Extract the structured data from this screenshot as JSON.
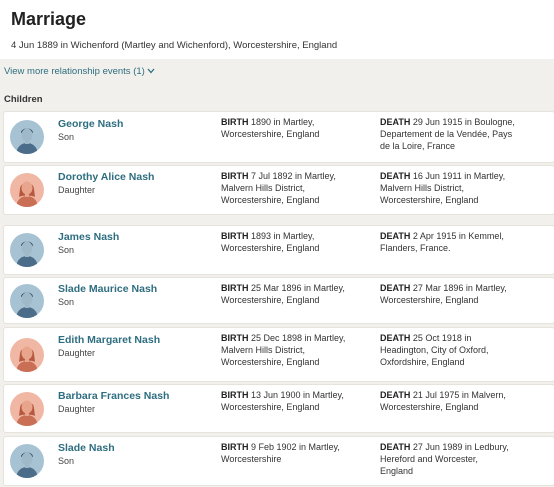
{
  "marriage": {
    "title": "Marriage",
    "detail": "4 Jun 1889 in Wichenford (Martley and Wichenford), Worcestershire, England"
  },
  "view_more": {
    "label": "View more relationship events (1)",
    "icon": "chevron-down-icon"
  },
  "children_heading": "Children",
  "event_labels": {
    "birth": "BIRTH",
    "death": "DEATH"
  },
  "colors": {
    "link": "#2e6e80",
    "male_avatar_bg": "#a7c3d3",
    "female_avatar_bg": "#f0b8a4"
  },
  "children": [
    {
      "name": "George Nash",
      "relation": "Son",
      "gender": "male",
      "birth_lines": [
        "1890 in Martley,",
        "Worcestershire, England"
      ],
      "death_lines": [
        "29 Jun 1915 in Boulogne,",
        "Departement de la Vendée, Pays",
        "de la Loire, France"
      ]
    },
    {
      "name": "Dorothy Alice Nash",
      "relation": "Daughter",
      "gender": "female",
      "birth_lines": [
        "7 Jul 1892 in Martley,",
        "Malvern Hills District,",
        "Worcestershire, England"
      ],
      "death_lines": [
        "16 Jun 1911 in Martley,",
        "Malvern Hills District,",
        "Worcestershire, England"
      ]
    },
    {
      "name": "James Nash",
      "relation": "Son",
      "gender": "male",
      "birth_lines": [
        "1893 in Martley,",
        "Worcestershire, England"
      ],
      "death_lines": [
        "2 Apr 1915 in Kemmel,",
        "Flanders, France."
      ]
    },
    {
      "name": "Slade Maurice Nash",
      "relation": "Son",
      "gender": "male",
      "birth_lines": [
        "25 Mar 1896 in Martley,",
        "Worcestershire, England"
      ],
      "death_lines": [
        "27 Mar 1896 in Martley,",
        "Worcestershire, England"
      ]
    },
    {
      "name": "Edith Margaret Nash",
      "relation": "Daughter",
      "gender": "female",
      "birth_lines": [
        "25 Dec 1898 in Martley,",
        "Malvern Hills District,",
        "Worcestershire, England"
      ],
      "death_lines": [
        "25 Oct 1918 in",
        "Headington, City of Oxford,",
        "Oxfordshire, England"
      ]
    },
    {
      "name": "Barbara Frances Nash",
      "relation": "Daughter",
      "gender": "female",
      "birth_lines": [
        "13 Jun 1900 in Martley,",
        "Worcestershire, England"
      ],
      "death_lines": [
        "21 Jul 1975 in Malvern,",
        "Worcestershire, England"
      ]
    },
    {
      "name": "Slade Nash",
      "relation": "Son",
      "gender": "male",
      "birth_lines": [
        "9 Feb 1902 in Martley,",
        "Worcestershire"
      ],
      "death_lines": [
        "27 Jun 1989 in Ledbury,",
        "Hereford and Worcester,",
        "England"
      ]
    }
  ]
}
